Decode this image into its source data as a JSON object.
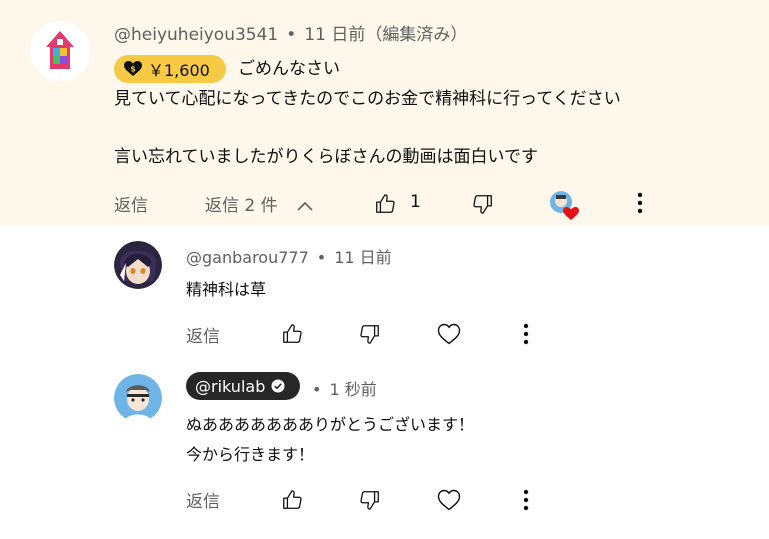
{
  "top_comment": {
    "author": "@heiyuheiyou3541",
    "separator": "•",
    "timestamp": "11 日前（編集済み）",
    "donation_amount": "￥1,600",
    "lines": [
      "ごめんなさい",
      "見ていて心配になってきたのでこのお金で精神科に行ってください",
      "言い忘れていましたがりくらぼさんの動画は面白いです"
    ],
    "reply_label": "返信",
    "replies_toggle": "返信 2 件",
    "like_count": "1",
    "colors": {
      "background": "#fdf8eb",
      "donation_chip": "#f7ca45"
    },
    "icons": [
      "chevron-up-icon",
      "thumbs-up-icon",
      "thumbs-down-icon",
      "creator-heart-icon",
      "more-vert-icon"
    ]
  },
  "replies": [
    {
      "author": "@ganbarou777",
      "separator": "•",
      "timestamp": "11 日前",
      "lines": [
        "精神科は草"
      ],
      "reply_label": "返信"
    },
    {
      "author": "@rikulab",
      "separator": "•",
      "timestamp": "1 秒前",
      "lines": [
        "ぬああああああありがとうございます！",
        "今から行きます！"
      ],
      "reply_label": "返信",
      "author_is_channel_owner": true
    }
  ]
}
